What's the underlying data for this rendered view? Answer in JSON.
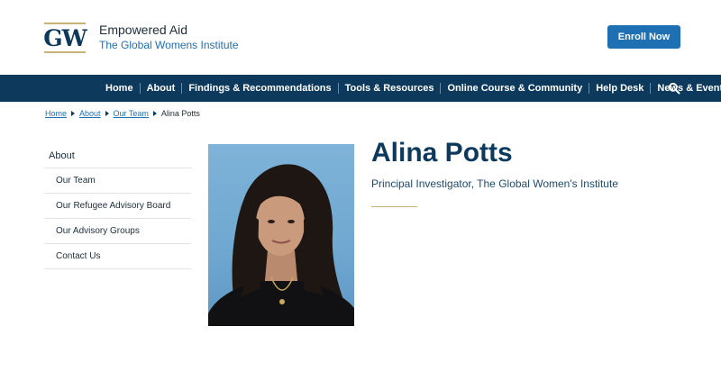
{
  "header": {
    "logo_text": "GW",
    "site_name": "Empowered Aid",
    "site_subtitle": "The Global Womens Institute",
    "enroll_label": "Enroll Now"
  },
  "nav": {
    "items": [
      {
        "label": "Home"
      },
      {
        "label": "About"
      },
      {
        "label": "Findings & Recommendations"
      },
      {
        "label": "Tools & Resources"
      },
      {
        "label": "Online Course & Community"
      },
      {
        "label": "Help Desk"
      },
      {
        "label": "News & Events"
      }
    ],
    "search_icon": "search-icon"
  },
  "breadcrumb": {
    "items": [
      "Home",
      "About",
      "Our Team"
    ],
    "current": "Alina Potts"
  },
  "sidebar": {
    "top": "About",
    "items": [
      {
        "label": "Our Team"
      },
      {
        "label": "Our Refugee Advisory Board"
      },
      {
        "label": "Our Advisory Groups"
      },
      {
        "label": "Contact Us"
      }
    ]
  },
  "profile": {
    "name": "Alina Potts",
    "title": "Principal Investigator, The Global Women's Institute"
  },
  "colors": {
    "primary": "#0d3a5c",
    "accent": "#1f6fb3",
    "gold": "#c8b277"
  }
}
